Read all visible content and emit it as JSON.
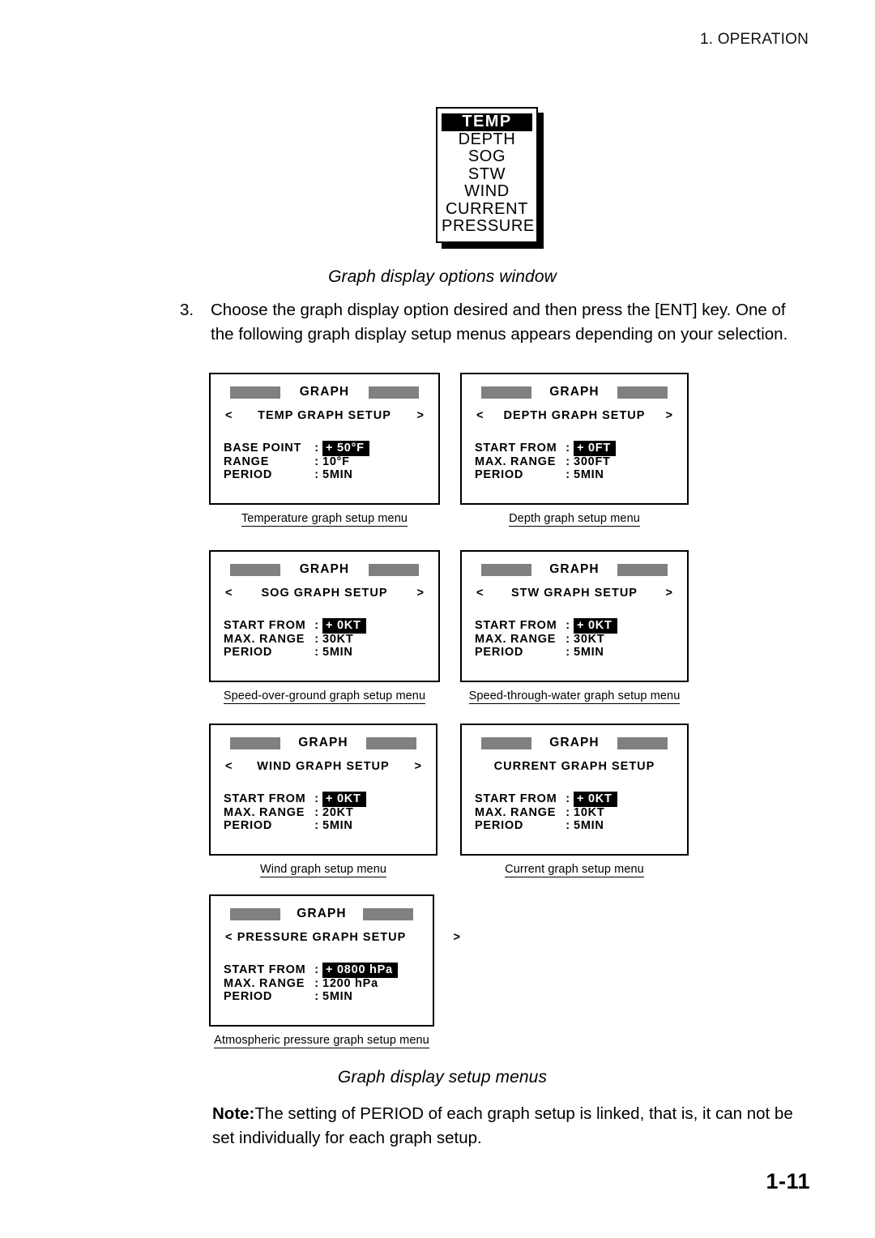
{
  "header": {
    "running_head": "1. OPERATION"
  },
  "options_window": {
    "items": [
      {
        "label": "TEMP",
        "selected": true
      },
      {
        "label": "DEPTH",
        "selected": false
      },
      {
        "label": "SOG",
        "selected": false
      },
      {
        "label": "STW",
        "selected": false
      },
      {
        "label": "WIND",
        "selected": false
      },
      {
        "label": "CURRENT",
        "selected": false
      },
      {
        "label": "PRESSURE",
        "selected": false
      }
    ],
    "caption": "Graph display options window"
  },
  "step": {
    "number": "3.",
    "text": "Choose the graph display option desired and then press the [ENT] key. One of the following graph display setup menus appears depending on your selection."
  },
  "menus": [
    {
      "screen_title": "GRAPH",
      "subtitle": "TEMP GRAPH SETUP",
      "left_arrow": "<",
      "right_arrow": ">",
      "arrow_outside": false,
      "rows": [
        {
          "label": "BASE POINT",
          "sep": ":",
          "value": "+  50°F",
          "highlight": true
        },
        {
          "label": "RANGE",
          "sep": ":",
          "value": "10°F",
          "highlight": false
        },
        {
          "label": "PERIOD",
          "sep": ":",
          "value": "5MIN",
          "highlight": false
        }
      ],
      "caption": "Temperature graph setup menu"
    },
    {
      "screen_title": "GRAPH",
      "subtitle": "DEPTH GRAPH SETUP",
      "left_arrow": "<",
      "right_arrow": ">",
      "arrow_outside": false,
      "rows": [
        {
          "label": "START FROM",
          "sep": ":",
          "value": "+   0FT",
          "highlight": true
        },
        {
          "label": "MAX. RANGE",
          "sep": ":",
          "value": "300FT",
          "highlight": false
        },
        {
          "label": "PERIOD",
          "sep": ":",
          "value": "5MIN",
          "highlight": false
        }
      ],
      "caption": "Depth graph setup menu"
    },
    {
      "screen_title": "GRAPH",
      "subtitle": "SOG GRAPH SETUP",
      "left_arrow": "<",
      "right_arrow": ">",
      "arrow_outside": false,
      "rows": [
        {
          "label": "START FROM",
          "sep": ":",
          "value": "+   0KT",
          "highlight": true
        },
        {
          "label": "MAX. RANGE",
          "sep": ":",
          "value": "30KT",
          "highlight": false
        },
        {
          "label": "PERIOD",
          "sep": ":",
          "value": "5MIN",
          "highlight": false
        }
      ],
      "caption": "Speed-over-ground graph setup menu"
    },
    {
      "screen_title": "GRAPH",
      "subtitle": "STW GRAPH SETUP",
      "left_arrow": "<",
      "right_arrow": ">",
      "arrow_outside": false,
      "rows": [
        {
          "label": "START FROM",
          "sep": ":",
          "value": "+   0KT",
          "highlight": true
        },
        {
          "label": "MAX. RANGE",
          "sep": ":",
          "value": "30KT",
          "highlight": false
        },
        {
          "label": "PERIOD",
          "sep": ":",
          "value": "5MIN",
          "highlight": false
        }
      ],
      "caption": "Speed-through-water graph setup menu"
    },
    {
      "screen_title": "GRAPH",
      "subtitle": "WIND GRAPH SETUP",
      "left_arrow": "<",
      "right_arrow": ">",
      "arrow_outside": false,
      "rows": [
        {
          "label": "START FROM",
          "sep": ":",
          "value": "+   0KT",
          "highlight": true
        },
        {
          "label": "MAX. RANGE",
          "sep": ":",
          "value": "20KT",
          "highlight": false
        },
        {
          "label": "PERIOD",
          "sep": ":",
          "value": "5MIN",
          "highlight": false
        }
      ],
      "caption": "Wind graph setup menu"
    },
    {
      "screen_title": "GRAPH",
      "subtitle": "CURRENT GRAPH SETUP",
      "left_arrow": "",
      "right_arrow": "",
      "arrow_outside": false,
      "rows": [
        {
          "label": "START FROM",
          "sep": ":",
          "value": "+   0KT",
          "highlight": true
        },
        {
          "label": "MAX. RANGE",
          "sep": ":",
          "value": "10KT",
          "highlight": false
        },
        {
          "label": "PERIOD",
          "sep": ":",
          "value": "5MIN",
          "highlight": false
        }
      ],
      "caption": "Current graph setup menu"
    },
    {
      "screen_title": "GRAPH",
      "subtitle": "PRESSURE GRAPH SETUP",
      "left_arrow": "<",
      "right_arrow": ">",
      "arrow_outside": true,
      "rows": [
        {
          "label": "START FROM",
          "sep": ":",
          "value": "+  0800 hPa",
          "highlight": true
        },
        {
          "label": "MAX. RANGE",
          "sep": ":",
          "value": "1200 hPa",
          "highlight": false
        },
        {
          "label": "PERIOD",
          "sep": ":",
          "value": "5MIN",
          "highlight": false
        }
      ],
      "caption": "Atmospheric pressure graph setup menu"
    }
  ],
  "setup_caption": "Graph display setup menus",
  "note": {
    "label": "Note:",
    "text": "The setting of PERIOD of each graph setup is linked, that is, it can not be set individually for each graph setup."
  },
  "page_number": "1-11",
  "colors": {
    "bar_grey": "#808080",
    "ink": "#000000",
    "paper": "#ffffff"
  }
}
